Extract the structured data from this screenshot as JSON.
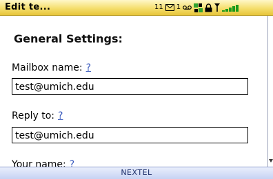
{
  "title_bar": {
    "title": "Edit te...",
    "message_count": "11",
    "other_count": "1",
    "icons": [
      "envelope-icon",
      "voicemail-icon",
      "network-icon",
      "lock-icon",
      "signal-antenna-icon",
      "signal-strength-icon"
    ]
  },
  "settings": {
    "heading": "General Settings:",
    "help_text": "?",
    "mailbox_label": "Mailbox name:",
    "mailbox_value": "test@umich.edu",
    "reply_label": "Reply to:",
    "reply_value": "test@umich.edu",
    "your_name_label": "Your name:"
  },
  "carrier": {
    "name": "NEXTEL"
  },
  "colors": {
    "title_bar": "#f5df6e",
    "help_link": "#3355bb",
    "carrier_bar": "#c7d3f3"
  }
}
